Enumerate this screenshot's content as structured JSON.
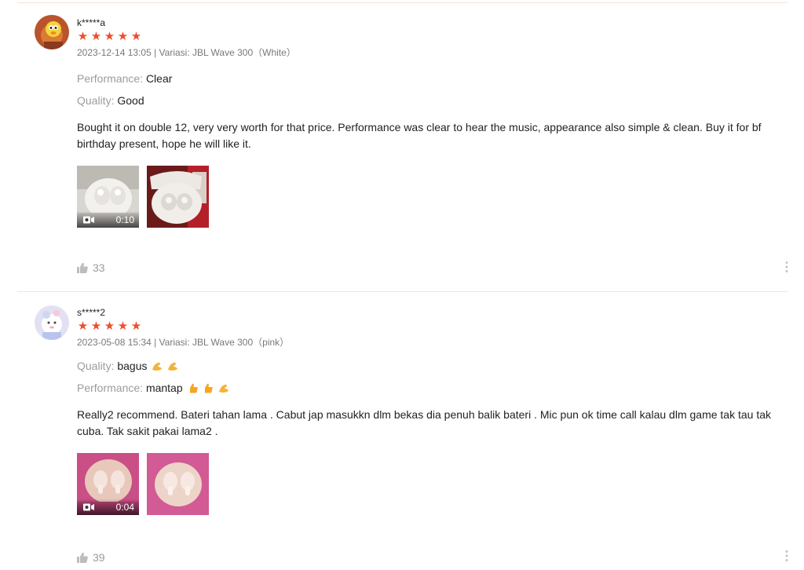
{
  "reviews": [
    {
      "username": "k*****a",
      "rating": 5,
      "meta": "2023-12-14 13:05 | Variasi: JBL Wave 300（White）",
      "attributes": [
        {
          "key": "Performance: ",
          "value": "Clear"
        },
        {
          "key": "Quality: ",
          "value": "Good"
        }
      ],
      "text": "Bought it on double 12, very very worth for that price. Performance was clear to hear the music, appearance also simple & clean. Buy it for bf birthday present, hope he will like it.",
      "video_duration": "0:10",
      "likes": "33"
    },
    {
      "username": "s*****2",
      "rating": 5,
      "meta": "2023-05-08 15:34 | Variasi: JBL Wave 300（pink）",
      "attributes": [
        {
          "key": "Quality: ",
          "value": "bagus"
        },
        {
          "key": "Performance: ",
          "value": "mantap"
        }
      ],
      "text": "Really2 recommend. Bateri tahan lama . Cabut jap masukkn dlm bekas dia penuh balik bateri . Mic pun ok time call kalau dlm game tak tau tak cuba. Tak sakit pakai lama2 .",
      "video_duration": "0:04",
      "likes": "39"
    }
  ],
  "colors": {
    "star": "#ee4d2d",
    "muted_text": "#757575",
    "label_text": "#999999",
    "divider": "#e8e8e8"
  },
  "icons": [
    "star-icon",
    "video-camera-icon",
    "thumbs-up-icon",
    "more-vertical-icon",
    "strong-arm-emoji-icon",
    "thumbs-up-emoji-icon"
  ]
}
